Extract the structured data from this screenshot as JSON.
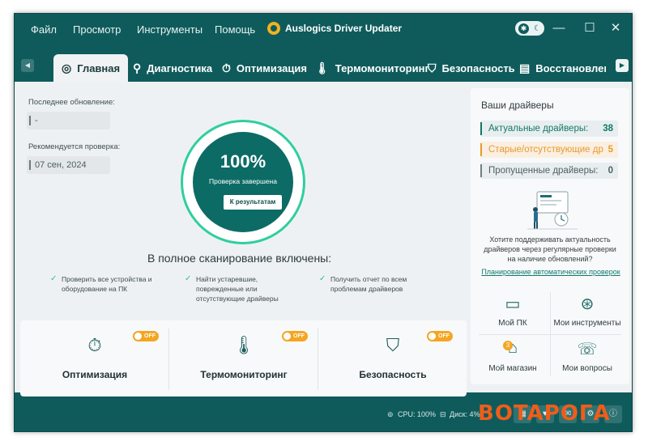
{
  "app": {
    "title": "Auslogics Driver Updater"
  },
  "menu": [
    "Файл",
    "Просмотр",
    "Инструменты",
    "Помощь"
  ],
  "icons": {
    "theme_sun": "sun-icon",
    "theme_moon": "moon-icon",
    "minimize": "minimize-icon",
    "maximize": "maximize-icon",
    "close": "close-icon"
  },
  "tabs": [
    {
      "label": "Главная",
      "icon": "target-icon",
      "active": true
    },
    {
      "label": "Диагностика",
      "icon": "search-icon",
      "active": false
    },
    {
      "label": "Оптимизация",
      "icon": "stopwatch-icon",
      "active": false
    },
    {
      "label": "Термомониторинг",
      "icon": "thermometer-icon",
      "active": false
    },
    {
      "label": "Безопасность",
      "icon": "shield-icon",
      "active": false
    },
    {
      "label": "Восстановление",
      "icon": "restore-icon",
      "active": false
    }
  ],
  "left": {
    "last_update_label": "Последнее обновление:",
    "last_update_value": "-",
    "recommended_label": "Рекомендуется проверка:",
    "recommended_value": "07 сен, 2024"
  },
  "gauge": {
    "percent_text": "100%",
    "percent": 100,
    "status": "Проверка завершена",
    "results_button": "К результатам"
  },
  "scan": {
    "title": "В полное сканирование включены:",
    "features": [
      "Проверить все устройства и оборудование на ПК",
      "Найти устаревшие, поврежденные или отсутствующие драйверы",
      "Получить отчет по всем проблемам драйверов"
    ]
  },
  "cards": [
    {
      "title": "Оптимизация",
      "icon": "stopwatch-icon",
      "toggle": "OFF"
    },
    {
      "title": "Термомониторинг",
      "icon": "thermometer-icon",
      "toggle": "OFF"
    },
    {
      "title": "Безопасность",
      "icon": "shield-icon",
      "toggle": "OFF"
    }
  ],
  "drivers": {
    "title": "Ваши драйверы",
    "items": [
      {
        "label": "Актуальные драйверы:",
        "count": "38",
        "kind": "ok"
      },
      {
        "label": "Старые/отсутствующие др",
        "count": "5",
        "kind": "old"
      },
      {
        "label": "Пропущенные драйверы:",
        "count": "0",
        "kind": "skip"
      }
    ],
    "promo_text": "Хотите поддерживать актуальность драйверов через регулярные проверки на наличие обновлений?",
    "schedule_link": "Планирование автоматических проверок"
  },
  "quick": [
    {
      "label": "Мой ПК",
      "icon": "monitor-icon"
    },
    {
      "label": "Мои инструменты",
      "icon": "tools-icon"
    },
    {
      "label": "Мой магазин",
      "icon": "store-icon",
      "badge": "3"
    },
    {
      "label": "Мои вопросы",
      "icon": "support-icon"
    }
  ],
  "status": {
    "cpu": "CPU: 100%",
    "disk": "Диск: 4%"
  },
  "watermark": "BOTAPOГA",
  "colors": {
    "primary": "#0f5b5c",
    "accent": "#2fcf9d",
    "warning": "#f4a621",
    "link": "#0f7a6b"
  }
}
